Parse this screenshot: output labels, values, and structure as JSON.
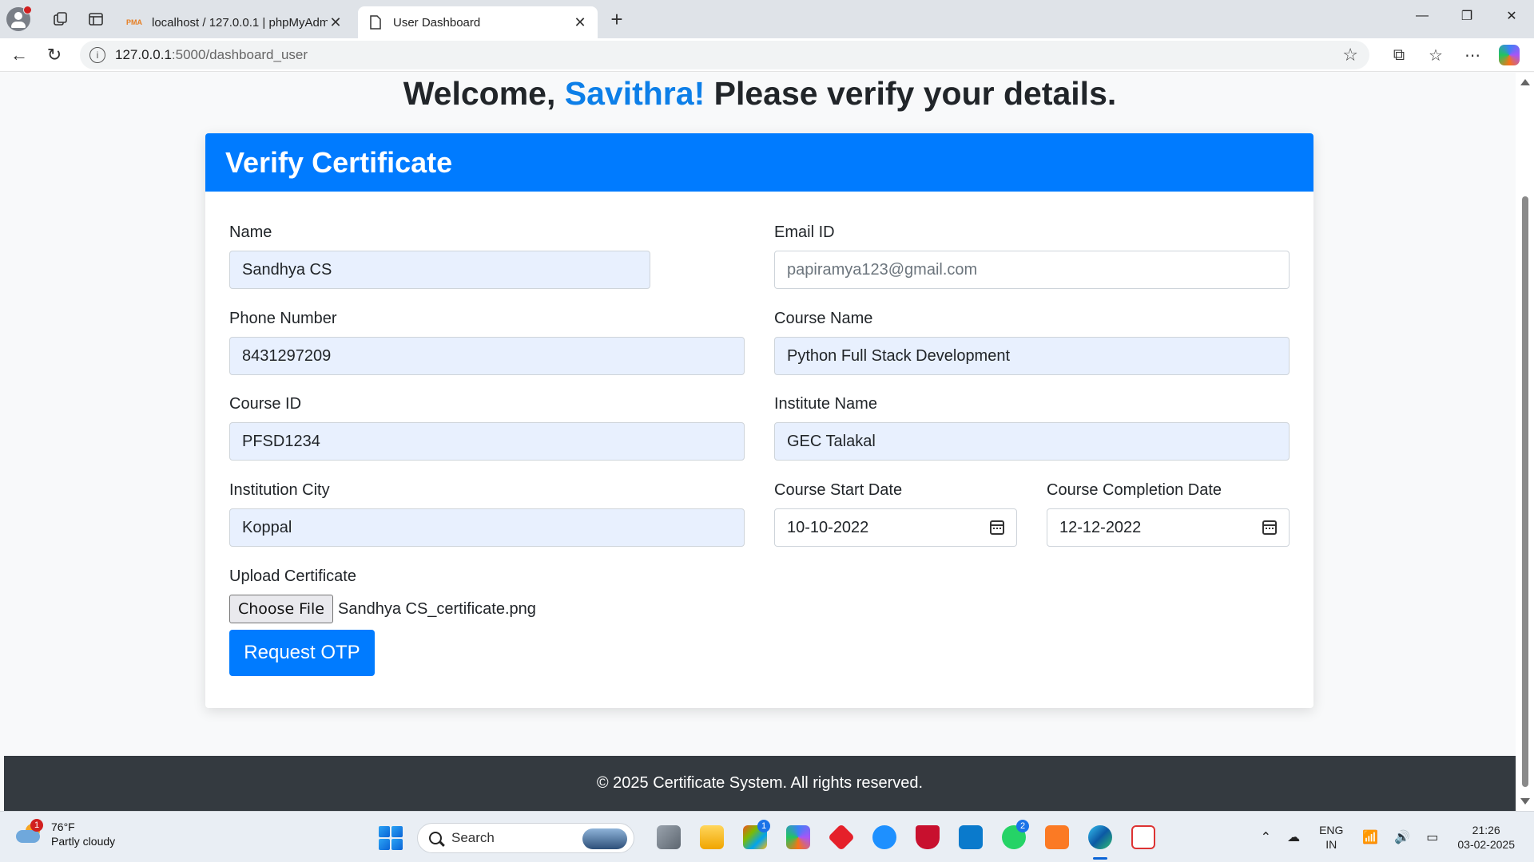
{
  "browser": {
    "tabs": [
      {
        "title": "localhost / 127.0.0.1 | phpMyAdm",
        "favicon": "phpmyadmin-icon",
        "favicon_text": "PMA"
      },
      {
        "title": "User Dashboard",
        "favicon": "page-icon"
      }
    ],
    "url_host": "127.0.0.1",
    "url_path": ":5000/dashboard_user"
  },
  "page": {
    "welcome_prefix": "Welcome, ",
    "username": "Savithra!",
    "welcome_suffix": " Please verify your details.",
    "card_title": "Verify Certificate",
    "fields": {
      "name": {
        "label": "Name",
        "value": "Sandhya CS"
      },
      "email": {
        "label": "Email ID",
        "value": "papiramya123@gmail.com"
      },
      "phone": {
        "label": "Phone Number",
        "value": "8431297209"
      },
      "course_name": {
        "label": "Course Name",
        "value": "Python Full Stack Development"
      },
      "course_id": {
        "label": "Course ID",
        "value": "PFSD1234"
      },
      "institute": {
        "label": "Institute Name",
        "value": "GEC Talakal"
      },
      "city": {
        "label": "Institution City",
        "value": "Koppal"
      },
      "start_date": {
        "label": "Course Start Date",
        "value": "10-10-2022"
      },
      "end_date": {
        "label": "Course Completion Date",
        "value": "12-12-2022"
      },
      "upload": {
        "label": "Upload Certificate",
        "button": "Choose File",
        "filename": "Sandhya CS_certificate.png"
      }
    },
    "submit_label": "Request OTP",
    "footer": "© 2025 Certificate System. All rights reserved."
  },
  "taskbar": {
    "weather_temp": "76°F",
    "weather_desc": "Partly cloudy",
    "weather_badge": "1",
    "search_placeholder": "Search",
    "apps": [
      {
        "name": "task-view-icon",
        "badge": ""
      },
      {
        "name": "file-explorer-icon",
        "badge": ""
      },
      {
        "name": "microsoft-store-icon",
        "badge": "1"
      },
      {
        "name": "copilot-app-icon",
        "badge": ""
      },
      {
        "name": "red-app-icon",
        "badge": ""
      },
      {
        "name": "help-icon",
        "badge": ""
      },
      {
        "name": "mcafee-icon",
        "badge": ""
      },
      {
        "name": "vscode-icon",
        "badge": ""
      },
      {
        "name": "whatsapp-icon",
        "badge": "2"
      },
      {
        "name": "xampp-icon",
        "badge": ""
      },
      {
        "name": "edge-icon",
        "badge": ""
      },
      {
        "name": "snipping-tool-icon",
        "badge": ""
      }
    ],
    "lang_top": "ENG",
    "lang_bottom": "IN",
    "time": "21:26",
    "date": "03-02-2025"
  },
  "colors": {
    "primary": "#007bff",
    "username": "#0d7fe8",
    "footer_bg": "#343a40",
    "autofill_bg": "#e8f0fe"
  }
}
